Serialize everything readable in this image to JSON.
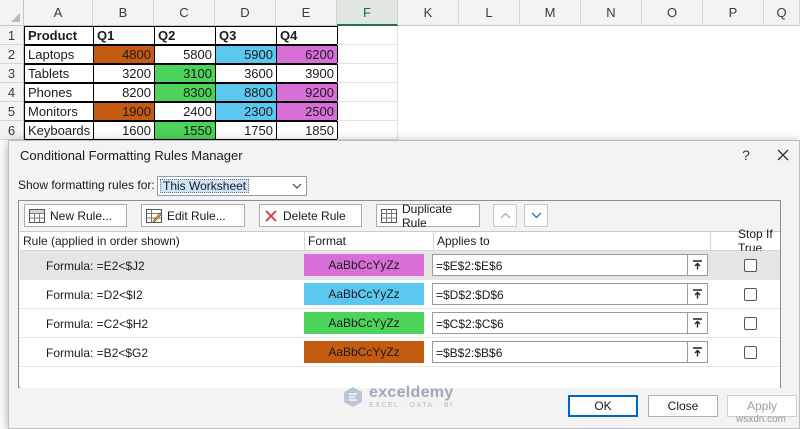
{
  "sheet": {
    "columns": [
      "A",
      "B",
      "C",
      "D",
      "E",
      "F",
      "K",
      "L",
      "M",
      "N",
      "O",
      "P",
      "Q"
    ],
    "selected_column": "F",
    "row_numbers": [
      "1",
      "2",
      "3",
      "4",
      "5",
      "6"
    ],
    "header": [
      "Product",
      "Q1",
      "Q2",
      "Q3",
      "Q4"
    ],
    "rows": [
      {
        "product": "Laptops",
        "q1": "4800",
        "q2": "5800",
        "q3": "5900",
        "q4": "6200"
      },
      {
        "product": "Tablets",
        "q1": "3200",
        "q2": "3100",
        "q3": "3600",
        "q4": "3900"
      },
      {
        "product": "Phones",
        "q1": "8200",
        "q2": "8300",
        "q3": "8800",
        "q4": "9200"
      },
      {
        "product": "Monitors",
        "q1": "1900",
        "q2": "2400",
        "q3": "2300",
        "q4": "2500"
      },
      {
        "product": "Keyboards",
        "q1": "1600",
        "q2": "1550",
        "q3": "1750",
        "q4": "1850"
      }
    ],
    "highlight": {
      "q1": [
        true,
        false,
        false,
        true,
        false
      ],
      "q2": [
        false,
        true,
        true,
        false,
        true
      ],
      "q3": [
        true,
        false,
        true,
        true,
        false
      ],
      "q4": [
        true,
        false,
        true,
        true,
        false
      ]
    },
    "colors": {
      "q1": "#c55a11",
      "q2": "#4cd35a",
      "q3": "#5bc8f0",
      "q4": "#d86fd8"
    }
  },
  "dialog": {
    "title": "Conditional Formatting Rules Manager",
    "help": "?",
    "show_rules_label": "Show formatting rules for:",
    "show_rules_value": "This Worksheet",
    "toolbar": {
      "new_rule": "New Rule...",
      "edit_rule": "Edit Rule...",
      "delete_rule": "Delete Rule",
      "duplicate_rule": "Duplicate Rule"
    },
    "columns": {
      "rule": "Rule (applied in order shown)",
      "format": "Format",
      "applies_to": "Applies to",
      "stop_if_true": "Stop If True"
    },
    "rules": [
      {
        "formula": "Formula: =E2<$J2",
        "format_preview": "AaBbCcYyZz",
        "format_color": "#d86fd8",
        "applies_to": "=$E$2:$E$6",
        "stop_if_true": false
      },
      {
        "formula": "Formula: =D2<$I2",
        "format_preview": "AaBbCcYyZz",
        "format_color": "#5bc8f0",
        "applies_to": "=$D$2:$D$6",
        "stop_if_true": false
      },
      {
        "formula": "Formula: =C2<$H2",
        "format_preview": "AaBbCcYyZz",
        "format_color": "#4cd35a",
        "applies_to": "=$C$2:$C$6",
        "stop_if_true": false
      },
      {
        "formula": "Formula: =B2<$G2",
        "format_preview": "AaBbCcYyZz",
        "format_color": "#c55a11",
        "applies_to": "=$B$2:$B$6",
        "stop_if_true": false
      }
    ],
    "buttons": {
      "ok": "OK",
      "close": "Close",
      "apply": "Apply"
    },
    "watermark": {
      "name": "exceldemy",
      "tagline": "EXCEL · DATA · BI"
    }
  },
  "site_watermark": "wsxdn.com"
}
